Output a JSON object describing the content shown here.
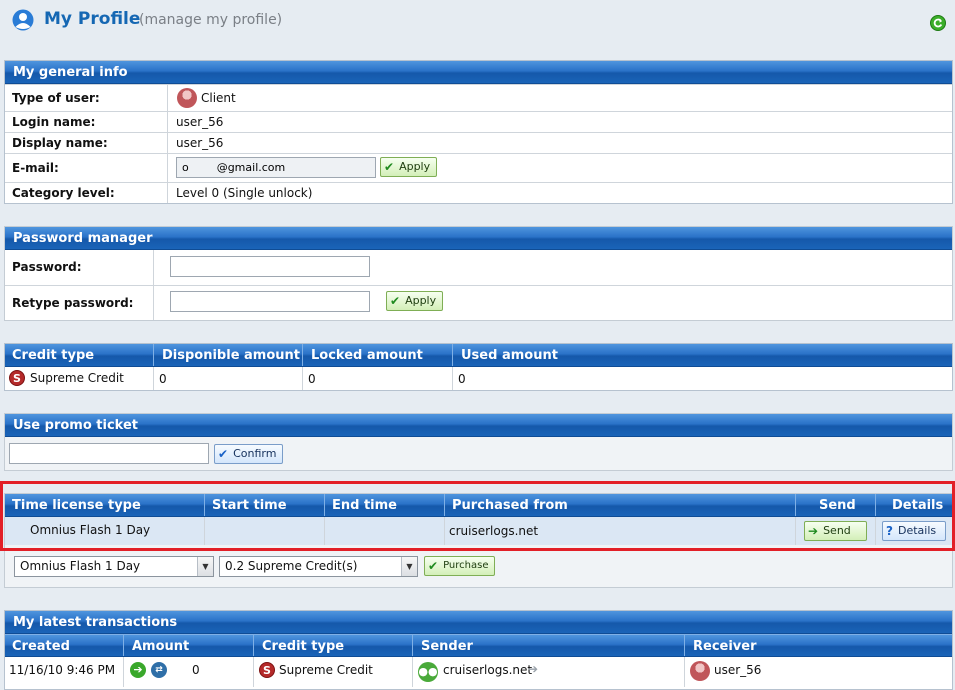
{
  "header": {
    "title": "My Profile",
    "subtitle": "(manage my profile)"
  },
  "general_info": {
    "title": "My general info",
    "rows": [
      {
        "label": "Type of user:",
        "value": "Client"
      },
      {
        "label": "Login name:",
        "value": "user_56"
      },
      {
        "label": "Display name:",
        "value": "user_56"
      },
      {
        "label": "E-mail:",
        "value": "o        @gmail.com"
      },
      {
        "label": "Category level:",
        "value": "Level 0 (Single unlock)"
      }
    ],
    "apply_label": "Apply"
  },
  "password_manager": {
    "title": "Password manager",
    "password_label": "Password:",
    "retype_label": "Retype password:",
    "password_value": "",
    "retype_value": "",
    "apply_label": "Apply"
  },
  "credits": {
    "headers": [
      "Credit type",
      "Disponible amount",
      "Locked amount",
      "Used amount"
    ],
    "rows": [
      {
        "type": "Supreme Credit",
        "disponible": "0",
        "locked": "0",
        "used": "0"
      }
    ]
  },
  "promo": {
    "title": "Use promo ticket",
    "input_value": "",
    "confirm_label": "Confirm"
  },
  "licenses": {
    "headers": [
      "Time license type",
      "Start time",
      "End time",
      "Purchased from",
      "Send",
      "Details"
    ],
    "rows": [
      {
        "type": "Omnius Flash 1 Day",
        "start": "",
        "end": "",
        "purchased_from": "cruiserlogs.net",
        "send_label": "Send",
        "details_label": "Details"
      }
    ],
    "license_select": "Omnius Flash 1 Day",
    "price_select": "0.2 Supreme Credit(s)",
    "purchase_label": "Purchase"
  },
  "transactions": {
    "title": "My latest transactions",
    "headers": [
      "Created",
      "Amount",
      "Credit type",
      "Sender",
      "Receiver"
    ],
    "rows": [
      {
        "created": "11/16/10 9:46 PM",
        "amount": "0",
        "credit_type": "Supreme Credit",
        "sender": "cruiserlogs.net",
        "receiver": "user_56"
      }
    ]
  },
  "colors": {
    "bar_blue": "#1a64b8",
    "title_blue": "#1567b3",
    "highlight_red": "#e21f27",
    "apply_green": "#d3efb8"
  }
}
